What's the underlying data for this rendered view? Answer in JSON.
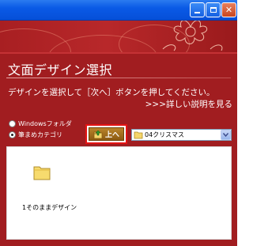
{
  "window": {
    "controls": [
      {
        "name": "minimize",
        "icon": "minimize-icon"
      },
      {
        "name": "maximize",
        "icon": "maximize-icon"
      },
      {
        "name": "close",
        "icon": "close-icon",
        "glyph": "✕"
      }
    ]
  },
  "page": {
    "title": "文面デザイン選択",
    "instruction": "デザインを選択して［次へ］ボタンを押してください。",
    "help_link": ">>>詳しい説明を見る"
  },
  "source": {
    "options": [
      {
        "label": "Windowsフォルダ",
        "selected": false
      },
      {
        "label": "筆まめカテゴリ",
        "selected": true
      }
    ]
  },
  "toolbar": {
    "up_label": "上へ",
    "up_icon": "folder-up-icon",
    "category_value": "04クリスマス",
    "category_icon": "folder-icon"
  },
  "files": [
    {
      "label": "1そのままデザイン",
      "icon": "folder-icon"
    }
  ],
  "colors": {
    "titlebar": "#0a5ae6",
    "panel": "#a11d20",
    "highlight": "#e41414",
    "up_button": "#a06d1d"
  }
}
